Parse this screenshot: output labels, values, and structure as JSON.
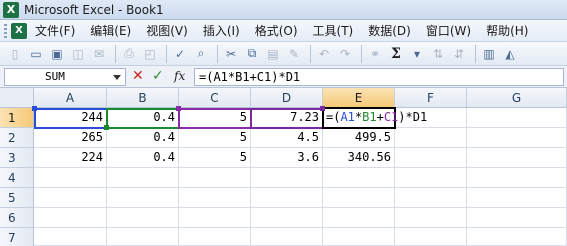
{
  "app": {
    "title": "Microsoft Excel - Book1",
    "icon_letter": "X"
  },
  "menu": {
    "items": [
      "文件(F)",
      "编辑(E)",
      "视图(V)",
      "插入(I)",
      "格式(O)",
      "工具(T)",
      "数据(D)",
      "窗口(W)",
      "帮助(H)"
    ]
  },
  "toolbar": {
    "sigma": "Σ"
  },
  "formula_bar": {
    "name_box": "SUM",
    "cancel_glyph": "✕",
    "enter_glyph": "✓",
    "fx_label": "fx",
    "formula": "=(A1*B1+C1)*D1"
  },
  "sheet": {
    "columns": [
      "A",
      "B",
      "C",
      "D",
      "E",
      "F",
      "G"
    ],
    "active_column": "E",
    "rows": [
      "1",
      "2",
      "3",
      "4",
      "5",
      "6",
      "7"
    ],
    "active_row": "1",
    "cells": [
      {
        "A": "244",
        "B": "0.4",
        "C": "5",
        "D": "7.23",
        "E": "=(A1*B1+C1)*D1"
      },
      {
        "A": "265",
        "B": "0.4",
        "C": "5",
        "D": "4.5",
        "E": "499.5"
      },
      {
        "A": "224",
        "B": "0.4",
        "C": "5",
        "D": "3.6",
        "E": "340.56"
      }
    ],
    "ref_colors": {
      "A1": "#2a4dd9",
      "B1": "#1e8a2e",
      "C1": "#8a2aa8",
      "D1": "#7a2a9c"
    },
    "formula_parts": [
      "=(",
      "A1",
      "*",
      "B1",
      "+",
      "C1",
      ")*D1"
    ]
  }
}
